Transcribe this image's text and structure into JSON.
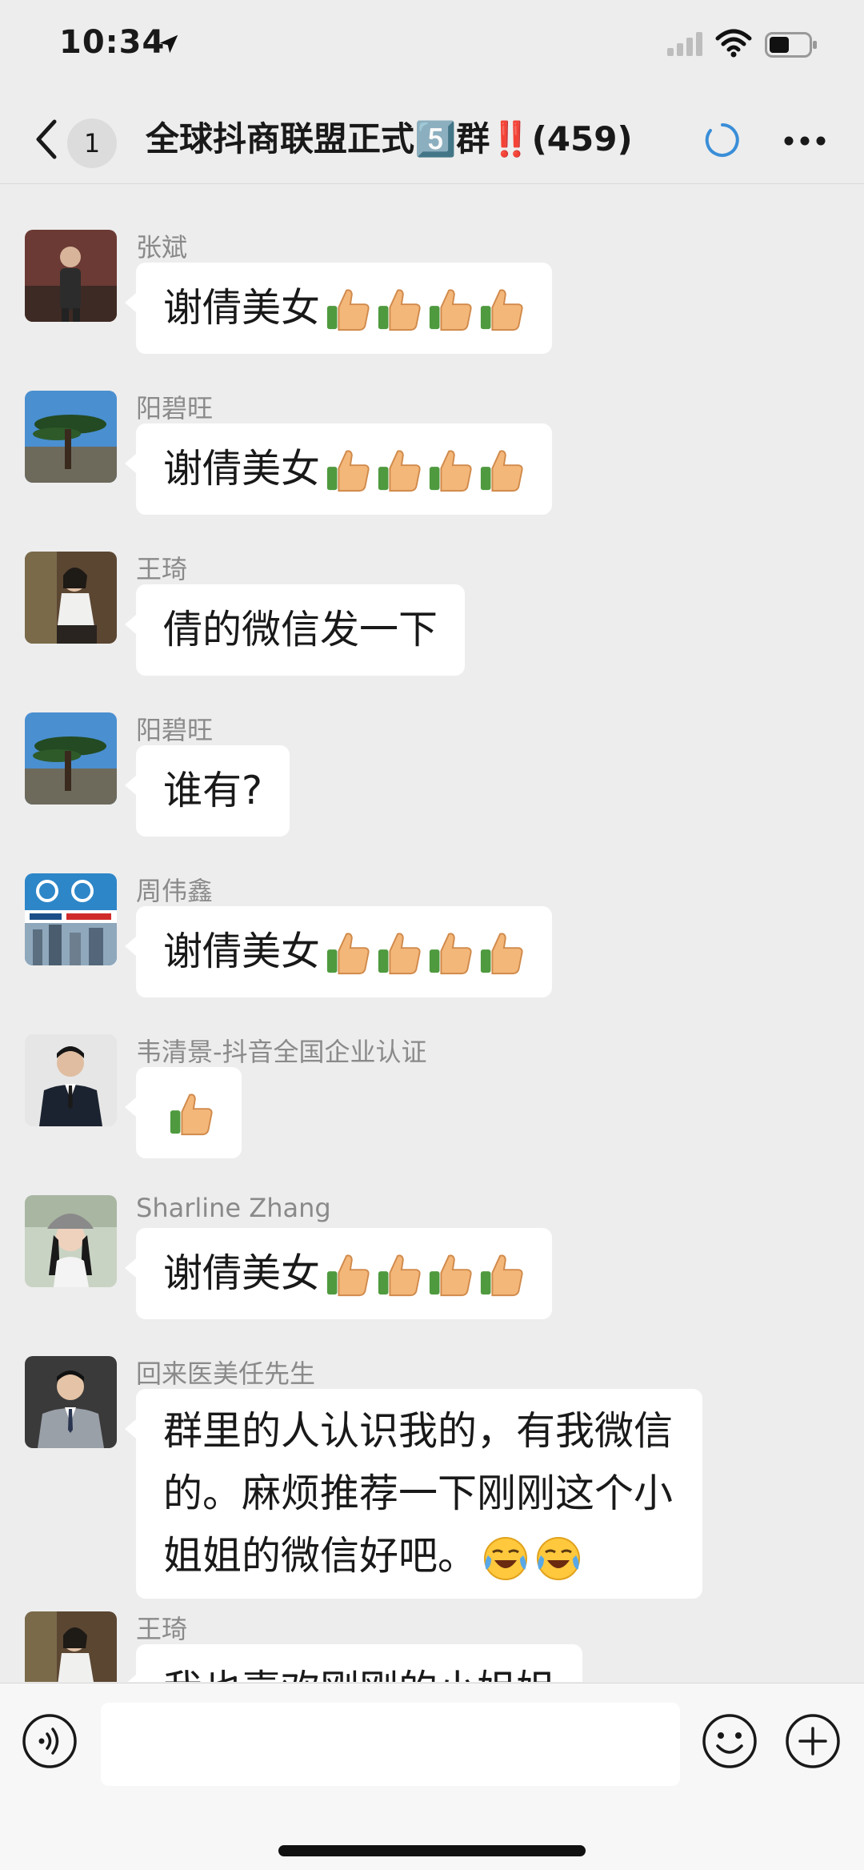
{
  "status_bar": {
    "time": "10:34"
  },
  "nav": {
    "unread_count": "1",
    "title": "全球抖商联盟正式5️⃣群‼️(459)"
  },
  "messages": [
    {
      "sender": "张斌",
      "text": "谢倩美女",
      "thumbs": 4,
      "avatar": "avatar-person-standing"
    },
    {
      "sender": "阳碧旺",
      "text": "谢倩美女",
      "thumbs": 4,
      "avatar": "avatar-pine-tree"
    },
    {
      "sender": "王琦",
      "text": "倩的微信发一下",
      "thumbs": 0,
      "avatar": "avatar-woman-sitting"
    },
    {
      "sender": "阳碧旺",
      "text": "谁有?",
      "thumbs": 0,
      "avatar": "avatar-pine-tree"
    },
    {
      "sender": "周伟鑫",
      "text": "谢倩美女",
      "thumbs": 4,
      "avatar": "avatar-city-billboard"
    },
    {
      "sender": "韦清景-抖音全国企业认证",
      "text": "",
      "thumbs": 1,
      "avatar": "avatar-man-suit"
    },
    {
      "sender": "Sharline Zhang",
      "text": "谢倩美女",
      "thumbs": 4,
      "avatar": "avatar-woman-cap"
    },
    {
      "sender": "回来医美任先生",
      "text": "群里的人认识我的，有我微信的。麻烦推荐一下刚刚这个小姐姐的微信好吧。",
      "thumbs": 0,
      "laughs": 2,
      "avatar": "avatar-man-grey-suit"
    },
    {
      "sender": "王琦",
      "text": "我也喜欢刚刚的小姐姐",
      "thumbs": 0,
      "avatar": "avatar-woman-sitting"
    }
  ],
  "icons": {
    "thumbs_up": "thumbs-up-icon",
    "laugh_cry": "laugh-cry-icon",
    "voice": "voice-icon",
    "emoji": "emoji-icon",
    "plus": "plus-icon"
  },
  "input": {
    "value": "",
    "placeholder": ""
  },
  "colors": {
    "background": "#ededed",
    "bubble": "#ffffff",
    "loading": "#3a8ed8",
    "sender": "#8a8a8a"
  }
}
